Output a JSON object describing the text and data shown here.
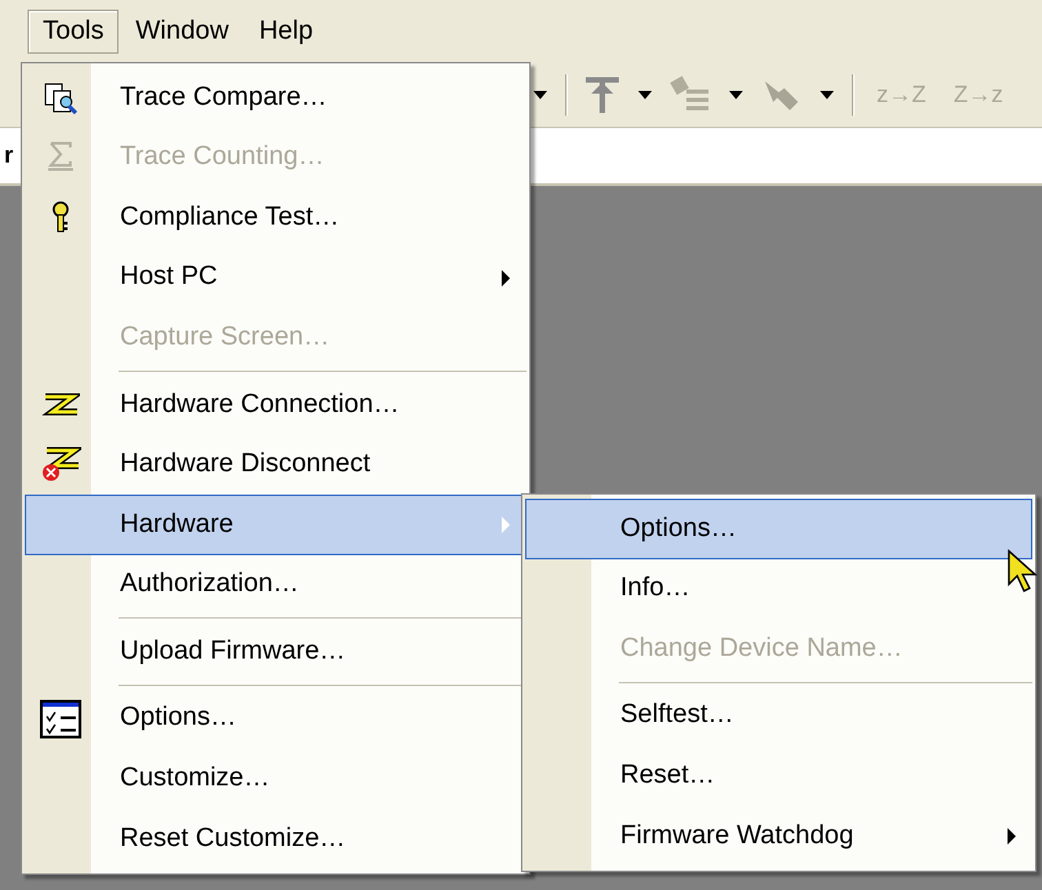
{
  "menubar": [
    {
      "label": "Tools",
      "selected": true
    },
    {
      "label": "Window",
      "selected": false
    },
    {
      "label": "Help",
      "selected": false
    }
  ],
  "toolbar": {
    "buttons": [
      {
        "label": "z→Z",
        "disabled": true
      },
      {
        "label": "Z→z",
        "disabled": true
      }
    ]
  },
  "left_edge_text": "r",
  "tools_menu": [
    {
      "kind": "item",
      "label": "Trace Compare…",
      "disabled": false,
      "submenu": false,
      "selected": false
    },
    {
      "kind": "item",
      "label": "Trace Counting…",
      "disabled": true,
      "submenu": false,
      "selected": false
    },
    {
      "kind": "item",
      "label": "Compliance Test…",
      "disabled": false,
      "submenu": false,
      "selected": false
    },
    {
      "kind": "item",
      "label": "Host PC",
      "disabled": false,
      "submenu": true,
      "selected": false
    },
    {
      "kind": "item",
      "label": "Capture Screen…",
      "disabled": true,
      "submenu": false,
      "selected": false
    },
    {
      "kind": "separator"
    },
    {
      "kind": "item",
      "label": "Hardware Connection…",
      "disabled": false,
      "submenu": false,
      "selected": false
    },
    {
      "kind": "item",
      "label": "Hardware Disconnect",
      "disabled": false,
      "submenu": false,
      "selected": false
    },
    {
      "kind": "item",
      "label": "Hardware",
      "disabled": false,
      "submenu": true,
      "selected": true
    },
    {
      "kind": "item",
      "label": "Authorization…",
      "disabled": false,
      "submenu": false,
      "selected": false
    },
    {
      "kind": "separator"
    },
    {
      "kind": "item",
      "label": "Upload Firmware…",
      "disabled": false,
      "submenu": false,
      "selected": false
    },
    {
      "kind": "separator"
    },
    {
      "kind": "item",
      "label": "Options…",
      "disabled": false,
      "submenu": false,
      "selected": false
    },
    {
      "kind": "item",
      "label": "Customize…",
      "disabled": false,
      "submenu": false,
      "selected": false
    },
    {
      "kind": "item",
      "label": "Reset Customize…",
      "disabled": false,
      "submenu": false,
      "selected": false
    }
  ],
  "hardware_submenu": [
    {
      "kind": "item",
      "label": "Options…",
      "disabled": false,
      "submenu": false,
      "selected": true
    },
    {
      "kind": "item",
      "label": "Info…",
      "disabled": false,
      "submenu": false,
      "selected": false
    },
    {
      "kind": "item",
      "label": "Change Device Name…",
      "disabled": true,
      "submenu": false,
      "selected": false
    },
    {
      "kind": "separator"
    },
    {
      "kind": "item",
      "label": "Selftest…",
      "disabled": false,
      "submenu": false,
      "selected": false
    },
    {
      "kind": "item",
      "label": "Reset…",
      "disabled": false,
      "submenu": false,
      "selected": false
    },
    {
      "kind": "item",
      "label": "Firmware Watchdog",
      "disabled": false,
      "submenu": true,
      "selected": false
    }
  ]
}
